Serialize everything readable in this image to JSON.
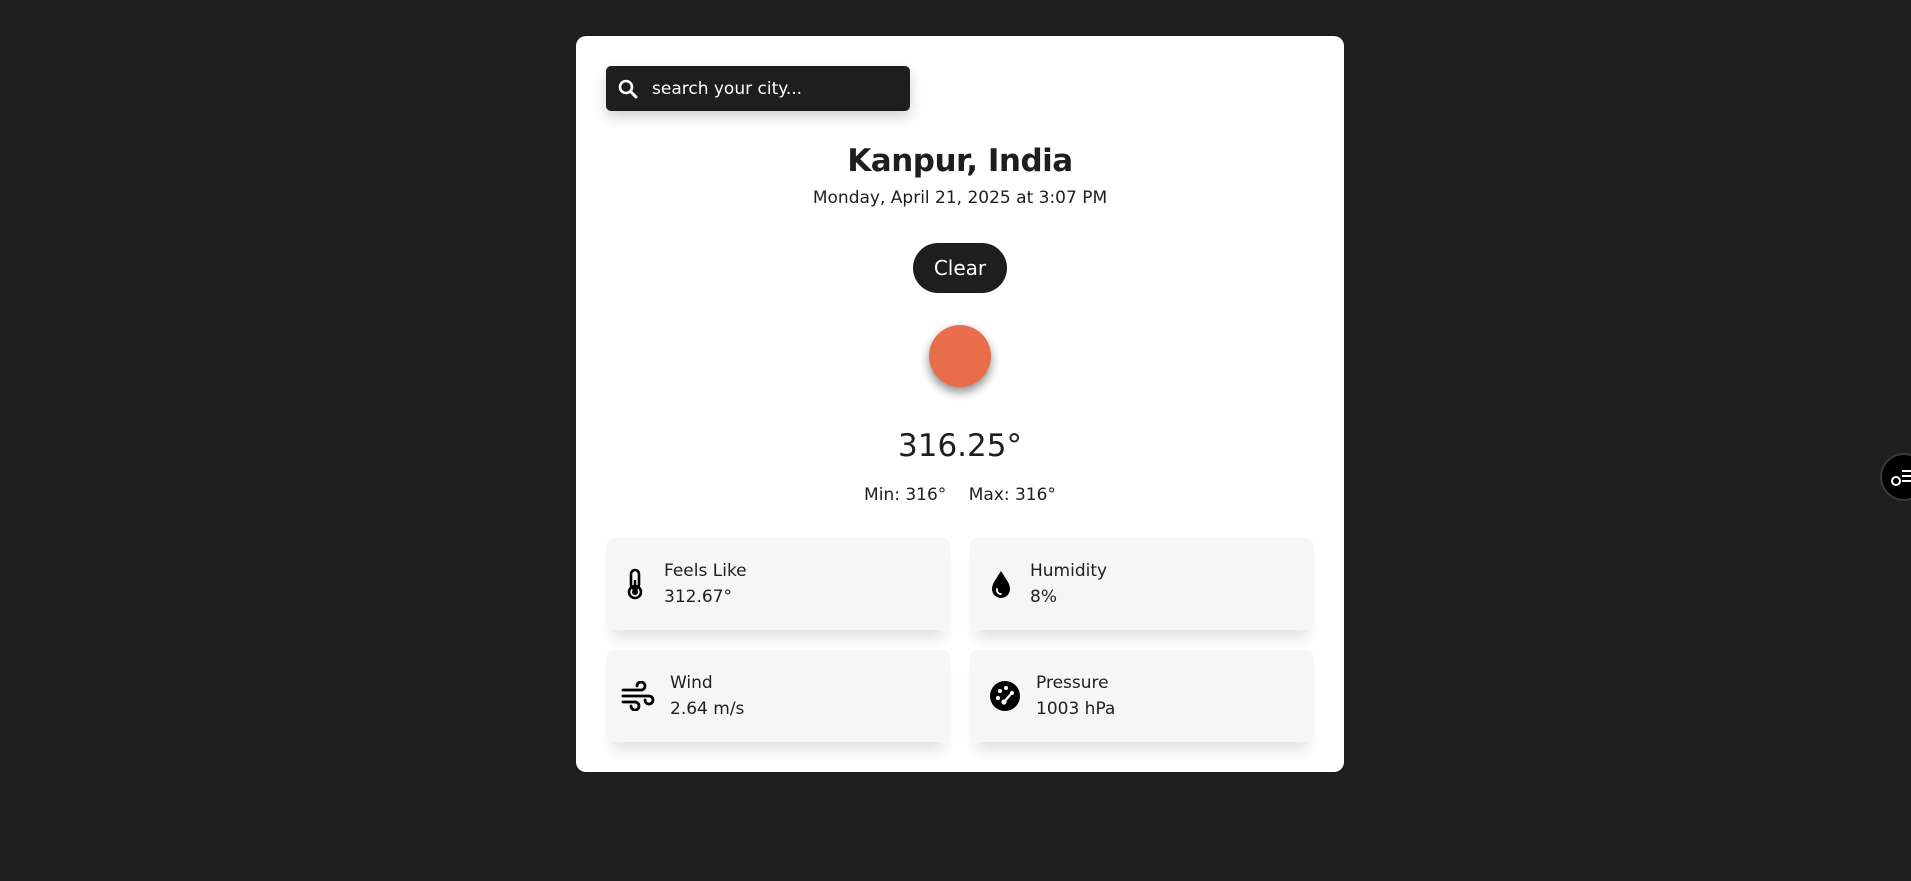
{
  "search": {
    "placeholder": "search your city..."
  },
  "location": {
    "city": "Kanpur, India",
    "datetime": "Monday, April 21, 2025 at 3:07 PM"
  },
  "weather": {
    "condition": "Clear",
    "temperature": "316.25°",
    "min": "Min: 316°",
    "max": "Max: 316°"
  },
  "stats": [
    {
      "label": "Feels Like",
      "value": "312.67°",
      "icon": "thermometer-icon"
    },
    {
      "label": "Humidity",
      "value": "8%",
      "icon": "droplet-icon"
    },
    {
      "label": "Wind",
      "value": "2.64 m/s",
      "icon": "wind-icon"
    },
    {
      "label": "Pressure",
      "value": "1003 hPa",
      "icon": "gauge-icon"
    }
  ],
  "colors": {
    "background": "#1e1e1e",
    "card": "#ffffff",
    "sun": "#e86e4b",
    "stat_card": "#f6f6f6"
  }
}
